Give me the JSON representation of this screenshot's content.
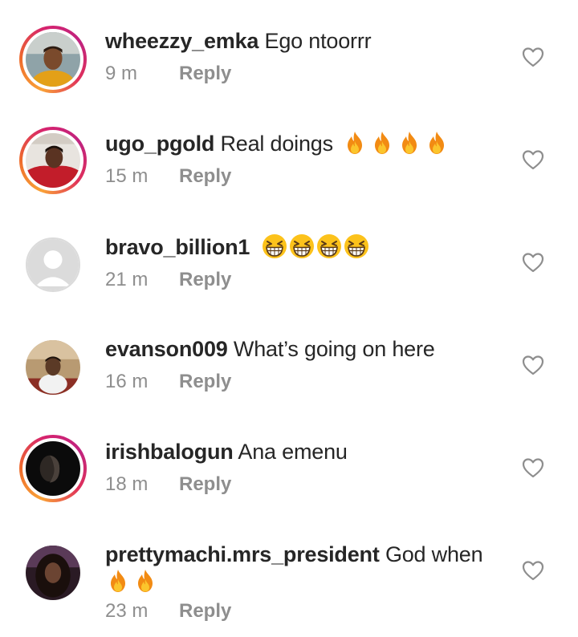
{
  "comments": [
    {
      "username": "wheezzy_emka",
      "text": "Ego ntoorrr",
      "time": "9 m",
      "reply_label": "Reply",
      "avatar_icon": "profile-photo",
      "story_ring": true,
      "emojis": []
    },
    {
      "username": "ugo_pgold",
      "text": "Real doings",
      "time": "15 m",
      "reply_label": "Reply",
      "avatar_icon": "profile-photo",
      "story_ring": true,
      "emojis": [
        "fire",
        "fire",
        "fire",
        "fire"
      ]
    },
    {
      "username": "bravo_billion1",
      "text": "",
      "time": "21 m",
      "reply_label": "Reply",
      "avatar_icon": "default-avatar-icon",
      "story_ring": false,
      "emojis": [
        "grinning-squinting-face",
        "grinning-squinting-face",
        "grinning-squinting-face",
        "grinning-squinting-face"
      ]
    },
    {
      "username": "evanson009",
      "text": "What’s going on here",
      "time": "16 m",
      "reply_label": "Reply",
      "avatar_icon": "profile-photo",
      "story_ring": false,
      "emojis": []
    },
    {
      "username": "irishbalogun",
      "text": "Ana emenu",
      "time": "18 m",
      "reply_label": "Reply",
      "avatar_icon": "profile-photo",
      "story_ring": true,
      "emojis": []
    },
    {
      "username": "prettymachi.mrs_president",
      "text": "God when",
      "time": "23 m",
      "reply_label": "Reply",
      "avatar_icon": "profile-photo",
      "story_ring": false,
      "emojis": [
        "fire",
        "fire"
      ]
    }
  ],
  "like_icon": "heart-outline-icon",
  "colors": {
    "text_primary": "#262626",
    "text_secondary": "#8e8e8e",
    "story_ring_start": "#f9a237",
    "story_ring_end": "#c0237f"
  }
}
